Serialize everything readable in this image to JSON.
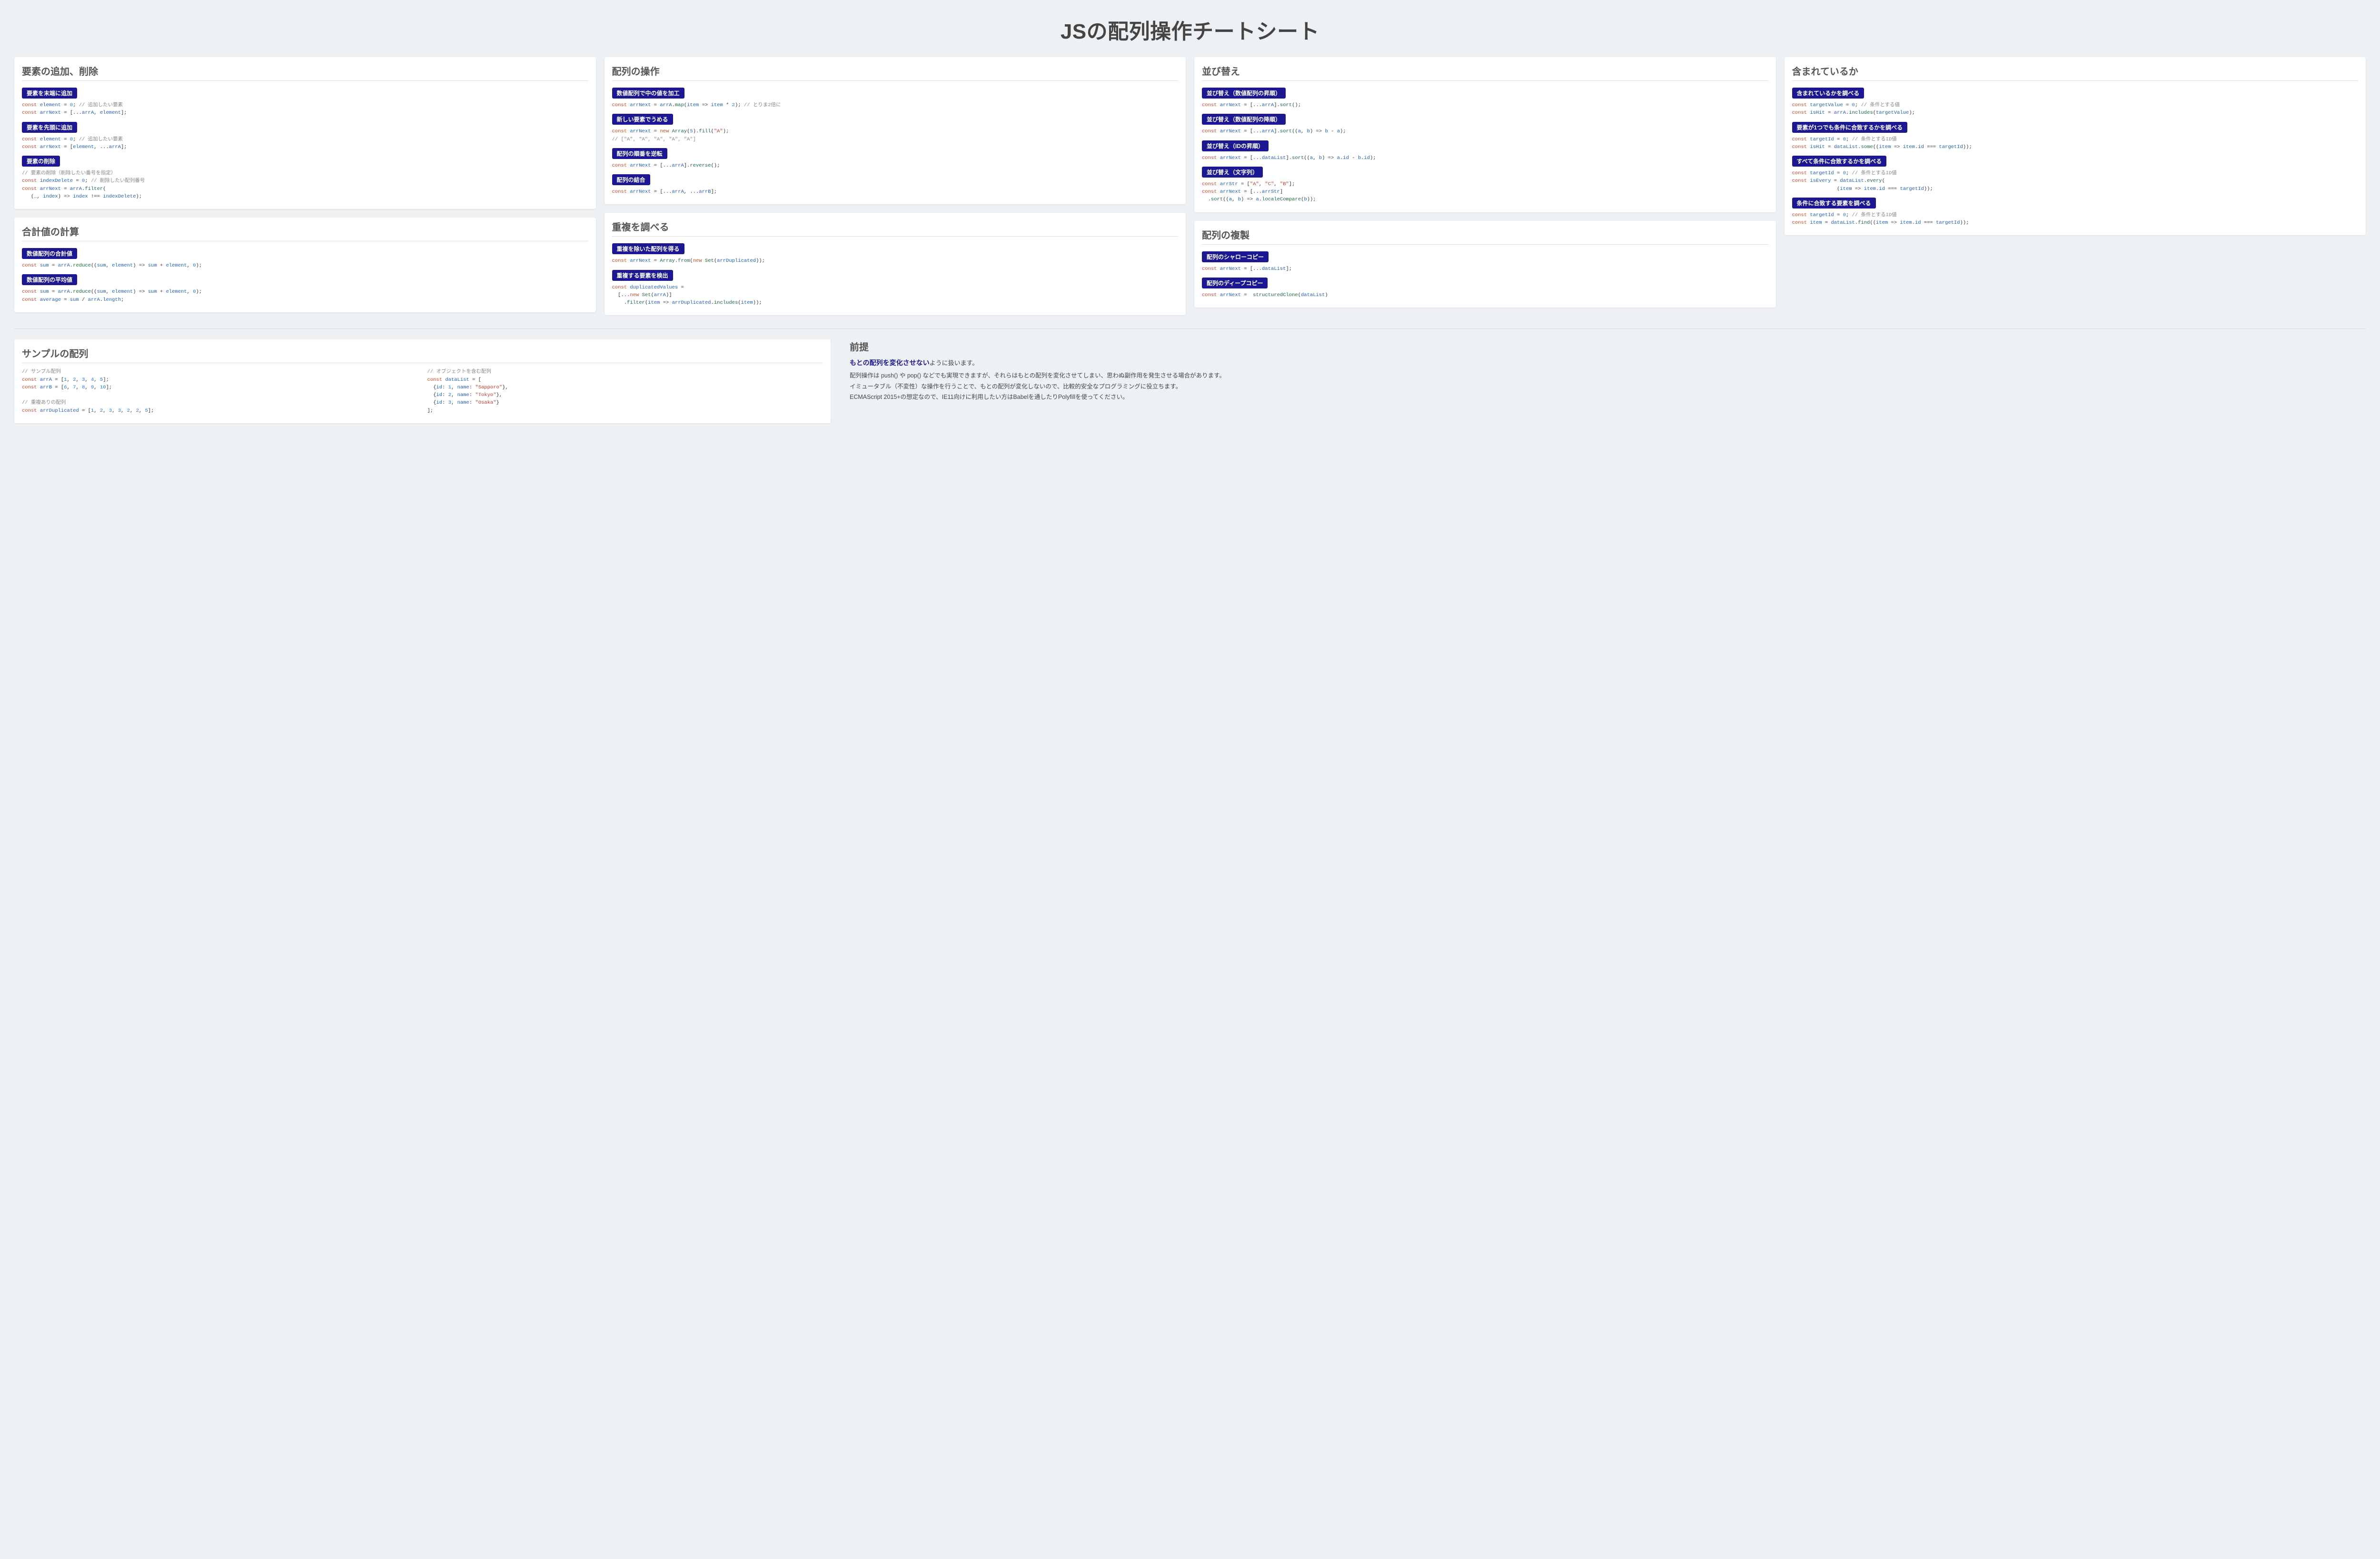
{
  "title": "JSの配列操作チートシート",
  "cards": {
    "add_remove": {
      "heading": "要素の追加、削除",
      "items": [
        {
          "label": "要素を末端に追加",
          "code_html": "<span class='kw'>const</span> <span class='name'>element</span> = <span class='num'>0</span>; <span class='cmt'>// 追加したい要素</span>\n<span class='kw'>const</span> <span class='name'>arrNext</span> = [...<span class='name'>arrA</span>, <span class='name'>element</span>];"
        },
        {
          "label": "要素を先頭に追加",
          "code_html": "<span class='kw'>const</span> <span class='name'>element</span> = <span class='num'>0</span>; <span class='cmt'>// 追加したい要素</span>\n<span class='kw'>const</span> <span class='name'>arrNext</span> = [<span class='name'>element</span>, ...<span class='name'>arrA</span>];"
        },
        {
          "label": "要素の削除",
          "code_html": "<span class='cmt'>// 要素の削除（削除したい番号を指定）</span>\n<span class='kw'>const</span> <span class='name'>indexDelete</span> = <span class='num'>0</span>; <span class='cmt'>// 削除したい配列番号</span>\n<span class='kw'>const</span> <span class='name'>arrNext</span> = <span class='name'>arrA</span>.<span class='fn'>filter</span>(\n   (<span class='name'>_</span>, <span class='name'>index</span>) <span class='punct'>=&gt;</span> <span class='name'>index</span> !== <span class='name'>indexDelete</span>);"
        }
      ]
    },
    "sum": {
      "heading": "合計値の計算",
      "items": [
        {
          "label": "数値配列の合計値",
          "code_html": "<span class='kw'>const</span> <span class='name'>sum</span> = <span class='name'>arrA</span>.<span class='fn'>reduce</span>((<span class='name'>sum</span>, <span class='name'>element</span>) <span class='punct'>=&gt;</span> <span class='name'>sum</span> + <span class='name'>element</span>, <span class='num'>0</span>);"
        },
        {
          "label": "数値配列の平均値",
          "code_html": "<span class='kw'>const</span> <span class='name'>sum</span> = <span class='name'>arrA</span>.<span class='fn'>reduce</span>((<span class='name'>sum</span>, <span class='name'>element</span>) <span class='punct'>=&gt;</span> <span class='name'>sum</span> + <span class='name'>element</span>, <span class='num'>0</span>);\n<span class='kw'>const</span> <span class='name'>average</span> = <span class='name'>sum</span> / <span class='name'>arrA</span>.<span class='name'>length</span>;"
        }
      ]
    },
    "manipulate": {
      "heading": "配列の操作",
      "items": [
        {
          "label": "数値配列で中の値を加工",
          "code_html": "<span class='kw'>const</span> <span class='name'>arrNext</span> = <span class='name'>arrA</span>.<span class='fn'>map</span>(<span class='name'>item</span> <span class='punct'>=&gt;</span> <span class='name'>item</span> * <span class='num'>2</span>); <span class='cmt'>// とりま2倍に</span>"
        },
        {
          "label": "新しい要素でうめる",
          "code_html": "<span class='kw'>const</span> <span class='name'>arrNext</span> = <span class='kw'>new</span> <span class='fn'>Array</span>(<span class='num'>5</span>).<span class='fn'>fill</span>(<span class='str'>\"A\"</span>);\n<span class='cmt'>// [\"A\", \"A\", \"A\", \"A\", \"A\"]</span>"
        },
        {
          "label": "配列の順番を逆転",
          "code_html": "<span class='kw'>const</span> <span class='name'>arrNext</span> = [...<span class='name'>arrA</span>].<span class='fn'>reverse</span>();"
        },
        {
          "label": "配列の結合",
          "code_html": "<span class='kw'>const</span> <span class='name'>arrNext</span> = [...<span class='name'>arrA</span>, ...<span class='name'>arrB</span>];"
        }
      ]
    },
    "dup": {
      "heading": "重複を調べる",
      "items": [
        {
          "label": "重複を除いた配列を得る",
          "code_html": "<span class='kw'>const</span> <span class='name'>arrNext</span> = <span class='fn'>Array</span>.<span class='fn'>from</span>(<span class='kw'>new</span> <span class='fn'>Set</span>(<span class='name'>arrDuplicated</span>));"
        },
        {
          "label": "重複する要素を検出",
          "code_html": "<span class='kw'>const</span> <span class='name'>duplicatedValues</span> =\n  [...<span class='kw'>new</span> <span class='fn'>Set</span>(<span class='name'>arrA</span>)]\n    .<span class='fn'>filter</span>(<span class='name'>item</span> <span class='punct'>=&gt;</span> <span class='name'>arrDuplicated</span>.<span class='fn'>includes</span>(<span class='name'>item</span>));"
        }
      ]
    },
    "sort": {
      "heading": "並び替え",
      "items": [
        {
          "label": "並び替え（数値配列の昇順）",
          "code_html": "<span class='kw'>const</span> <span class='name'>arrNext</span> = [...<span class='name'>arrA</span>].<span class='fn'>sort</span>();"
        },
        {
          "label": "並び替え（数値配列の降順）",
          "code_html": "<span class='kw'>const</span> <span class='name'>arrNext</span> = [...<span class='name'>arrA</span>].<span class='fn'>sort</span>((<span class='name'>a</span>, <span class='name'>b</span>) <span class='punct'>=&gt;</span> <span class='name'>b</span> - <span class='name'>a</span>);"
        },
        {
          "label": "並び替え（IDの昇順）",
          "code_html": "<span class='kw'>const</span> <span class='name'>arrNext</span> = [...<span class='name'>dataList</span>].<span class='fn'>sort</span>((<span class='name'>a</span>, <span class='name'>b</span>) <span class='punct'>=&gt;</span> <span class='name'>a</span>.<span class='name'>id</span> - <span class='name'>b</span>.<span class='name'>id</span>);"
        },
        {
          "label": "並び替え（文字列）",
          "code_html": "<span class='kw'>const</span> <span class='name'>arrStr</span> = [<span class='str'>\"A\"</span>, <span class='str'>\"C\"</span>, <span class='str'>\"B\"</span>];\n<span class='kw'>const</span> <span class='name'>arrNext</span> = [...<span class='name'>arrStr</span>]\n  .<span class='fn'>sort</span>((<span class='name'>a</span>, <span class='name'>b</span>) <span class='punct'>=&gt;</span> <span class='name'>a</span>.<span class='fn'>localeCompare</span>(<span class='name'>b</span>));"
        }
      ]
    },
    "copy": {
      "heading": "配列の複製",
      "items": [
        {
          "label": "配列のシャローコピー",
          "code_html": "<span class='kw'>const</span> <span class='name'>arrNext</span> = [...<span class='name'>dataList</span>];"
        },
        {
          "label": "配列のディープコピー",
          "code_html": "<span class='kw'>const</span> <span class='name'>arrNext</span> =  <span class='fn'>structuredClone</span>(<span class='name'>dataList</span>)"
        }
      ]
    },
    "contains": {
      "heading": "含まれているか",
      "items": [
        {
          "label": "含まれているかを調べる",
          "code_html": "<span class='kw'>const</span> <span class='name'>targetValue</span> = <span class='num'>0</span>; <span class='cmt'>// 条件とする値</span>\n<span class='kw'>const</span> <span class='name'>isHit</span> = <span class='name'>arrA</span>.<span class='fn'>includes</span>(<span class='name'>targetValue</span>);"
        },
        {
          "label": "要素が1つでも条件に合致するかを調べる",
          "code_html": "<span class='kw'>const</span> <span class='name'>targetId</span> = <span class='num'>0</span>; <span class='cmt'>// 条件とするID値</span>\n<span class='kw'>const</span> <span class='name'>isHit</span> = <span class='name'>dataList</span>.<span class='fn'>some</span>((<span class='name'>item</span> <span class='punct'>=&gt;</span> <span class='name'>item</span>.<span class='name'>id</span> === <span class='name'>targetId</span>));"
        },
        {
          "label": "すべて条件に合致するかを調べる",
          "code_html": "<span class='kw'>const</span> <span class='name'>targetId</span> = <span class='num'>0</span>; <span class='cmt'>// 条件とするID値</span>\n<span class='kw'>const</span> <span class='name'>isEvery</span> = <span class='name'>dataList</span>.<span class='fn'>every</span>(\n               (<span class='name'>item</span> <span class='punct'>=&gt;</span> <span class='name'>item</span>.<span class='name'>id</span> === <span class='name'>targetId</span>));"
        },
        {
          "label": "条件に合致する要素を調べる",
          "code_html": "<span class='kw'>const</span> <span class='name'>targetId</span> = <span class='num'>0</span>; <span class='cmt'>// 条件とするID値</span>\n<span class='kw'>const</span> <span class='name'>item</span> = <span class='name'>dataList</span>.<span class='fn'>find</span>((<span class='name'>item</span> <span class='punct'>=&gt;</span> <span class='name'>item</span>.<span class='name'>id</span> === <span class='name'>targetId</span>));"
        }
      ]
    }
  },
  "sample": {
    "heading": "サンプルの配列",
    "left_html": "<span class='cmt'>// サンプル配列</span>\n<span class='kw'>const</span> <span class='name'>arrA</span> = [<span class='num'>1</span>, <span class='num'>2</span>, <span class='num'>3</span>, <span class='num'>4</span>, <span class='num'>5</span>];\n<span class='kw'>const</span> <span class='name'>arrB</span> = [<span class='num'>6</span>, <span class='num'>7</span>, <span class='num'>8</span>, <span class='num'>9</span>, <span class='num'>10</span>];\n\n<span class='cmt'>// 重複ありの配列</span>\n<span class='kw'>const</span> <span class='name'>arrDuplicated</span> = [<span class='num'>1</span>, <span class='num'>2</span>, <span class='num'>3</span>, <span class='num'>3</span>, <span class='num'>2</span>, <span class='num'>2</span>, <span class='num'>5</span>];",
    "right_html": "<span class='cmt'>// オブジェクトを含む配列</span>\n<span class='kw'>const</span> <span class='name'>dataList</span> = [\n  {<span class='name'>id</span>: <span class='num'>1</span>, <span class='name'>name</span>: <span class='str'>\"Sapporo\"</span>},\n  {<span class='name'>id</span>: <span class='num'>2</span>, <span class='name'>name</span>: <span class='str'>\"Tokyo\"</span>},\n  {<span class='name'>id</span>: <span class='num'>3</span>, <span class='name'>name</span>: <span class='str'>\"Osaka\"</span>}\n];"
  },
  "premise": {
    "heading": "前提",
    "lead_bold": "もとの配列を変化させない",
    "lead_tail": "ように扱います。",
    "body": "配列操作は push() や pop() などでも実現できますが、それらはもとの配列を変化させてしまい、思わぬ副作用を発生させる場合があります。\nイミュータブル（不変性）な操作を行うことで、もとの配列が変化しないので、比較的安全なプログラミングに役立ちます。\nECMAScript 2015+の想定なので、IE11向けに利用したい方はBabelを通したりPolyfillを使ってください。"
  }
}
